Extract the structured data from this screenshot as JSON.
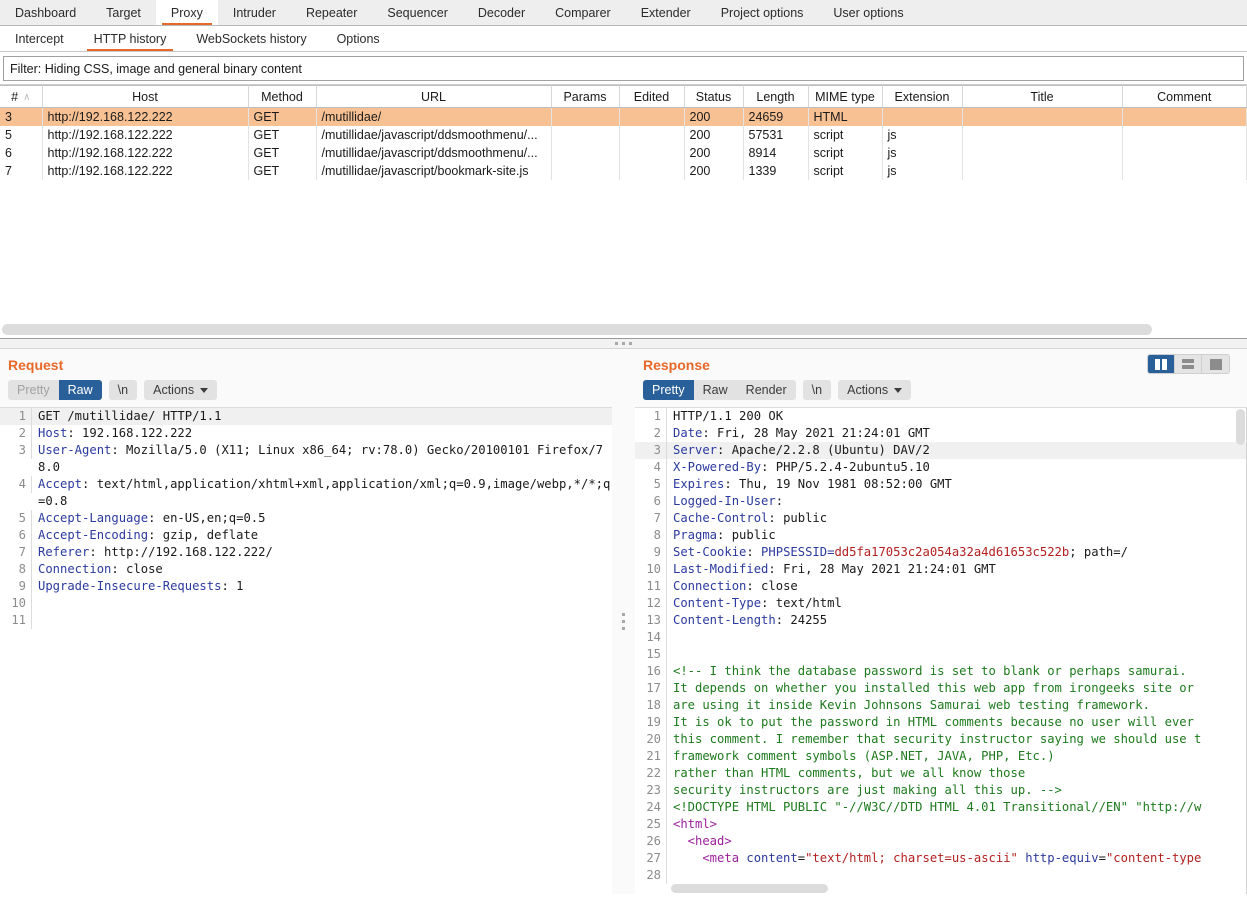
{
  "main_tabs": [
    {
      "label": "Dashboard",
      "active": false
    },
    {
      "label": "Target",
      "active": false
    },
    {
      "label": "Proxy",
      "active": true
    },
    {
      "label": "Intruder",
      "active": false
    },
    {
      "label": "Repeater",
      "active": false
    },
    {
      "label": "Sequencer",
      "active": false
    },
    {
      "label": "Decoder",
      "active": false
    },
    {
      "label": "Comparer",
      "active": false
    },
    {
      "label": "Extender",
      "active": false
    },
    {
      "label": "Project options",
      "active": false
    },
    {
      "label": "User options",
      "active": false
    }
  ],
  "sub_tabs": [
    {
      "label": "Intercept",
      "active": false
    },
    {
      "label": "HTTP history",
      "active": true
    },
    {
      "label": "WebSockets history",
      "active": false
    },
    {
      "label": "Options",
      "active": false
    }
  ],
  "filter": {
    "text": "Filter: Hiding CSS, image and general binary content"
  },
  "history_table": {
    "columns": [
      "#",
      "Host",
      "Method",
      "URL",
      "Params",
      "Edited",
      "Status",
      "Length",
      "MIME type",
      "Extension",
      "Title",
      "Comment"
    ],
    "sort_column": "#",
    "sort_arrow": "∧",
    "rows": [
      {
        "num": "3",
        "host": "http://192.168.122.222",
        "method": "GET",
        "url": "/mutillidae/",
        "params": "",
        "edited": "",
        "status": "200",
        "length": "24659",
        "mime": "HTML",
        "extension": "",
        "title": "",
        "comment": "",
        "selected": true
      },
      {
        "num": "5",
        "host": "http://192.168.122.222",
        "method": "GET",
        "url": "/mutillidae/javascript/ddsmoothmenu/...",
        "params": "",
        "edited": "",
        "status": "200",
        "length": "57531",
        "mime": "script",
        "extension": "js",
        "title": "",
        "comment": "",
        "selected": false
      },
      {
        "num": "6",
        "host": "http://192.168.122.222",
        "method": "GET",
        "url": "/mutillidae/javascript/ddsmoothmenu/...",
        "params": "",
        "edited": "",
        "status": "200",
        "length": "8914",
        "mime": "script",
        "extension": "js",
        "title": "",
        "comment": "",
        "selected": false
      },
      {
        "num": "7",
        "host": "http://192.168.122.222",
        "method": "GET",
        "url": "/mutillidae/javascript/bookmark-site.js",
        "params": "",
        "edited": "",
        "status": "200",
        "length": "1339",
        "mime": "script",
        "extension": "js",
        "title": "",
        "comment": "",
        "selected": false
      }
    ]
  },
  "layout_toggles": [
    {
      "name": "vertical-split",
      "active": true
    },
    {
      "name": "horizontal-split",
      "active": false
    },
    {
      "name": "single-pane",
      "active": false
    }
  ],
  "request": {
    "title": "Request",
    "views": [
      {
        "label": "Pretty",
        "state": "disabled"
      },
      {
        "label": "Raw",
        "state": "active"
      }
    ],
    "newline_label": "\\n",
    "actions_label": "Actions",
    "lines": [
      {
        "n": "1",
        "highlight": true,
        "text": "GET /mutillidae/ HTTP/1.1"
      },
      {
        "n": "2",
        "highlight": false,
        "header": "Host",
        "text": " 192.168.122.222"
      },
      {
        "n": "3",
        "highlight": false,
        "header": "User-Agent",
        "text": " Mozilla/5.0 (X11; Linux x86_64; rv:78.0) Gecko/20100101 Firefox/78.0"
      },
      {
        "n": "4",
        "highlight": false,
        "header": "Accept",
        "text": " text/html,application/xhtml+xml,application/xml;q=0.9,image/webp,*/*;q=0.8"
      },
      {
        "n": "5",
        "highlight": false,
        "header": "Accept-Language",
        "text": " en-US,en;q=0.5"
      },
      {
        "n": "6",
        "highlight": false,
        "header": "Accept-Encoding",
        "text": " gzip, deflate"
      },
      {
        "n": "7",
        "highlight": false,
        "header": "Referer",
        "text": " http://192.168.122.222/"
      },
      {
        "n": "8",
        "highlight": false,
        "header": "Connection",
        "text": " close"
      },
      {
        "n": "9",
        "highlight": false,
        "header": "Upgrade-Insecure-Requests",
        "text": " 1"
      },
      {
        "n": "10",
        "highlight": false,
        "text": ""
      },
      {
        "n": "11",
        "highlight": false,
        "text": ""
      }
    ]
  },
  "response": {
    "title": "Response",
    "views": [
      {
        "label": "Pretty",
        "state": "active"
      },
      {
        "label": "Raw",
        "state": "normal"
      },
      {
        "label": "Render",
        "state": "normal"
      }
    ],
    "newline_label": "\\n",
    "actions_label": "Actions",
    "lines": [
      {
        "n": "1",
        "highlight": false,
        "text": "HTTP/1.1 200 OK"
      },
      {
        "n": "2",
        "highlight": false,
        "header": "Date",
        "text": " Fri, 28 May 2021 21:24:01 GMT"
      },
      {
        "n": "3",
        "highlight": true,
        "header": "Server",
        "text": " Apache/2.2.8 (Ubuntu) DAV/2"
      },
      {
        "n": "4",
        "highlight": false,
        "header": "X-Powered-By",
        "text": " PHP/5.2.4-2ubuntu5.10"
      },
      {
        "n": "5",
        "highlight": false,
        "header": "Expires",
        "text": " Thu, 19 Nov 1981 08:52:00 GMT"
      },
      {
        "n": "6",
        "highlight": false,
        "header": "Logged-In-User",
        "text": ""
      },
      {
        "n": "7",
        "highlight": false,
        "header": "Cache-Control",
        "text": " public"
      },
      {
        "n": "8",
        "highlight": false,
        "header": "Pragma",
        "text": " public"
      },
      {
        "n": "9",
        "highlight": false,
        "header": "Set-Cookie",
        "cookie_name": " PHPSESSID=",
        "cookie_value": "dd5fa17053c2a054a32a4d61653c522b",
        "text": "; path=/"
      },
      {
        "n": "10",
        "highlight": false,
        "header": "Last-Modified",
        "text": " Fri, 28 May 2021 21:24:01 GMT"
      },
      {
        "n": "11",
        "highlight": false,
        "header": "Connection",
        "text": " close"
      },
      {
        "n": "12",
        "highlight": false,
        "header": "Content-Type",
        "text": " text/html"
      },
      {
        "n": "13",
        "highlight": false,
        "header": "Content-Length",
        "text": " 24255"
      },
      {
        "n": "14",
        "highlight": false,
        "text": ""
      },
      {
        "n": "15",
        "highlight": false,
        "text": ""
      },
      {
        "n": "16",
        "highlight": false,
        "kind": "comment",
        "text": "<!-- I think the database password is set to blank or perhaps samurai."
      },
      {
        "n": "17",
        "highlight": false,
        "kind": "comment",
        "text": "It depends on whether you installed this web app from irongeeks site or"
      },
      {
        "n": "18",
        "highlight": false,
        "kind": "comment",
        "text": "are using it inside Kevin Johnsons Samurai web testing framework."
      },
      {
        "n": "19",
        "highlight": false,
        "kind": "comment",
        "text": "It is ok to put the password in HTML comments because no user will ever"
      },
      {
        "n": "20",
        "highlight": false,
        "kind": "comment",
        "text": "this comment. I remember that security instructor saying we should use t"
      },
      {
        "n": "21",
        "highlight": false,
        "kind": "comment",
        "text": "framework comment symbols (ASP.NET, JAVA, PHP, Etc.)"
      },
      {
        "n": "22",
        "highlight": false,
        "kind": "comment",
        "text": "rather than HTML comments, but we all know those"
      },
      {
        "n": "23",
        "highlight": false,
        "kind": "comment",
        "text": "security instructors are just making all this up. -->"
      },
      {
        "n": "24",
        "highlight": false,
        "kind": "doctype",
        "text": "<!DOCTYPE HTML PUBLIC \"-//W3C//DTD HTML 4.01 Transitional//EN\" \"http://w"
      },
      {
        "n": "25",
        "highlight": false,
        "kind": "tag",
        "text": "<html>"
      },
      {
        "n": "26",
        "highlight": false,
        "kind": "tag",
        "text": "  <head>"
      },
      {
        "n": "27",
        "highlight": false,
        "kind": "meta",
        "tag_open": "    <meta ",
        "attr1": "content",
        "val1": "\"text/html; charset=us-ascii\"",
        "attr2": " http-equiv",
        "val2": "\"content-type"
      },
      {
        "n": "28",
        "highlight": false,
        "text": ""
      }
    ]
  }
}
